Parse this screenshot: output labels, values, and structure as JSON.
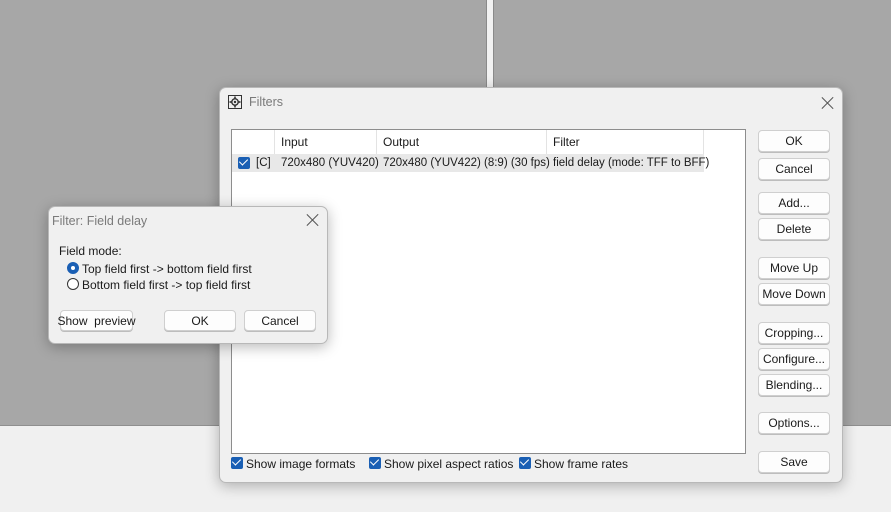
{
  "filters_window": {
    "title": "Filters",
    "columns": [
      "Input",
      "Output",
      "Filter"
    ],
    "rows": [
      {
        "checked": true,
        "tag": "[C]",
        "input": "720x480 (YUV420)",
        "output": "720x480 (YUV422) (8:9) (30 fps)",
        "filter": "field delay (mode: TFF to BFF)"
      }
    ],
    "buttons": {
      "ok": "OK",
      "cancel": "Cancel",
      "add": "Add...",
      "delete": "Delete",
      "move_up": "Move Up",
      "move_down": "Move Down",
      "cropping": "Cropping...",
      "configure": "Configure...",
      "blending": "Blending...",
      "options": "Options...",
      "save": "Save"
    },
    "options": {
      "show_image_formats": {
        "label": "Show image formats",
        "checked": true
      },
      "show_pixel_aspect_ratios": {
        "label": "Show pixel aspect ratios",
        "checked": true
      },
      "show_frame_rates": {
        "label": "Show frame rates",
        "checked": true
      }
    }
  },
  "field_delay_dialog": {
    "title": "Filter: Field delay",
    "group_label": "Field mode:",
    "options": [
      {
        "label": "Top field first -> bottom field first",
        "selected": true
      },
      {
        "label": "Bottom field first -> top field first",
        "selected": false
      }
    ],
    "buttons": {
      "show_preview": "Show  preview",
      "ok": "OK",
      "cancel": "Cancel"
    }
  },
  "colors": {
    "accent": "#1a5fb4",
    "background": "#a7a7a7",
    "dialog": "#f0f0f0"
  }
}
